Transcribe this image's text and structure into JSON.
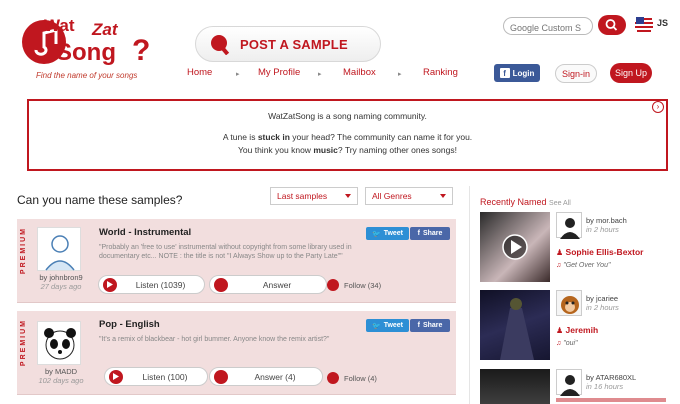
{
  "header": {
    "tagline": "Find the name of your songs",
    "post_sample_label": "POST A SAMPLE",
    "search_placeholder": "Google Custom S",
    "lang_label": "JS"
  },
  "nav": {
    "items": [
      "Home",
      "My Profile",
      "Mailbox",
      "Ranking"
    ],
    "fb_login_label": "Login",
    "signin_label": "Sign-in",
    "signup_label": "Sign Up"
  },
  "intro": {
    "line1": "WatZatSong is a song naming community.",
    "line2a": "A tune is ",
    "line2b": "stuck in",
    "line2c": " your head? The community can name it for you.",
    "line3a": "You think you know ",
    "line3b": "music",
    "line3c": "? Try naming other ones songs!"
  },
  "samples": {
    "heading": "Can you name these samples?",
    "filter_sort": "Last samples",
    "filter_genre": "All Genres",
    "premium_label": "PREMIUM",
    "tweet_label": "Tweet",
    "share_label": "Share",
    "items": [
      {
        "by": "by johnbron9",
        "age": "27 days ago",
        "title": "World - Instrumental",
        "description": "\"Probably an 'free to use' instrumental without copyright from some library used in documentary etc... NOTE : the title is not \"I Always Show up to the Party Late\"\"",
        "listen": "Listen (1039)",
        "answer": "Answer",
        "follow": "Follow (34)"
      },
      {
        "by": "by MADD",
        "age": "102 days ago",
        "title": "Pop - English",
        "description": "\"It's a remix of blackbear - hot girl bummer. Anyone know the remix artist?\"",
        "listen": "Listen (100)",
        "answer": "Answer (4)",
        "follow": "Follow (4)"
      }
    ]
  },
  "recently_named": {
    "title": "Recently Named",
    "see_all": "See All",
    "items": [
      {
        "user": "by mor.bach",
        "age": "in 2 hours",
        "artist": "Sophie Ellis-Bextor",
        "song": "\"Get Over You\""
      },
      {
        "user": "by jcariee",
        "age": "in 2 hours",
        "artist": "Jeremih",
        "song": "\"oui\""
      },
      {
        "user": "by ATAR680XL",
        "age": "in 16 hours",
        "artist": "",
        "song": ""
      }
    ]
  },
  "colors": {
    "brand_red": "#c0171f",
    "card_bg": "#f2dede",
    "facebook": "#3b5998",
    "twitter": "#2d8fd5"
  }
}
